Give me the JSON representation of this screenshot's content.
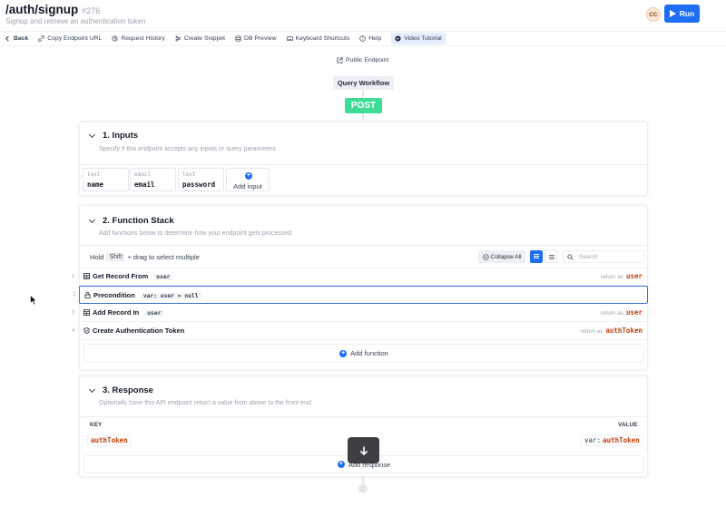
{
  "header": {
    "title": "/auth/signup",
    "id_badge": "#276",
    "subtitle": "Signup and retrieve an authentication token",
    "avatar": "CC",
    "run_label": "Run",
    "accent": "#1d6ef5"
  },
  "toolbar": {
    "back": "Back",
    "copy_url": "Copy Endpoint URL",
    "history": "Request History",
    "snippet": "Create Snippet",
    "db_preview": "DB Preview",
    "shortcuts": "Keyboard Shortcuts",
    "help": "Help",
    "video": "Video Tutorial"
  },
  "flow": {
    "public_endpoint": "Public Endpoint",
    "query_workflow": "Query Workflow",
    "method": "POST",
    "method_color": "#3ddc97"
  },
  "inputs": {
    "title": "1. Inputs",
    "desc": "Specify if this endpoint accepts any inputs or query parameters",
    "items": [
      {
        "type": "text",
        "name": "name"
      },
      {
        "type": "email",
        "name": "email"
      },
      {
        "type": "text",
        "name": "password"
      }
    ],
    "add_label": "Add input"
  },
  "functions": {
    "title": "2. Function Stack",
    "desc": "Add functions below to determine how your endpoint gets processed",
    "hold": "Hold",
    "shift": "Shift",
    "drag_hint": "+ drag to select multiple",
    "collapse": "Collapse All",
    "search_placeholder": "Search",
    "return_as": "return as",
    "rows": [
      {
        "num": "1",
        "name": "Get Record From",
        "tag": "user",
        "ret": "user"
      },
      {
        "num": "2",
        "name": "Precondition",
        "tag": "var: user = null",
        "ret": ""
      },
      {
        "num": "3",
        "name": "Add Record In",
        "tag": "user",
        "ret": "user"
      },
      {
        "num": "4",
        "name": "Create Authentication Token",
        "tag": "",
        "ret": "authToken"
      }
    ],
    "add_label": "Add function"
  },
  "response": {
    "title": "3. Response",
    "desc": "Optionally have this API endpoint return a value from above to the front-end",
    "key_header": "KEY",
    "value_header": "VALUE",
    "key": "authToken",
    "value_prefix": "var:",
    "value": "authToken",
    "add_label": "Add response"
  }
}
